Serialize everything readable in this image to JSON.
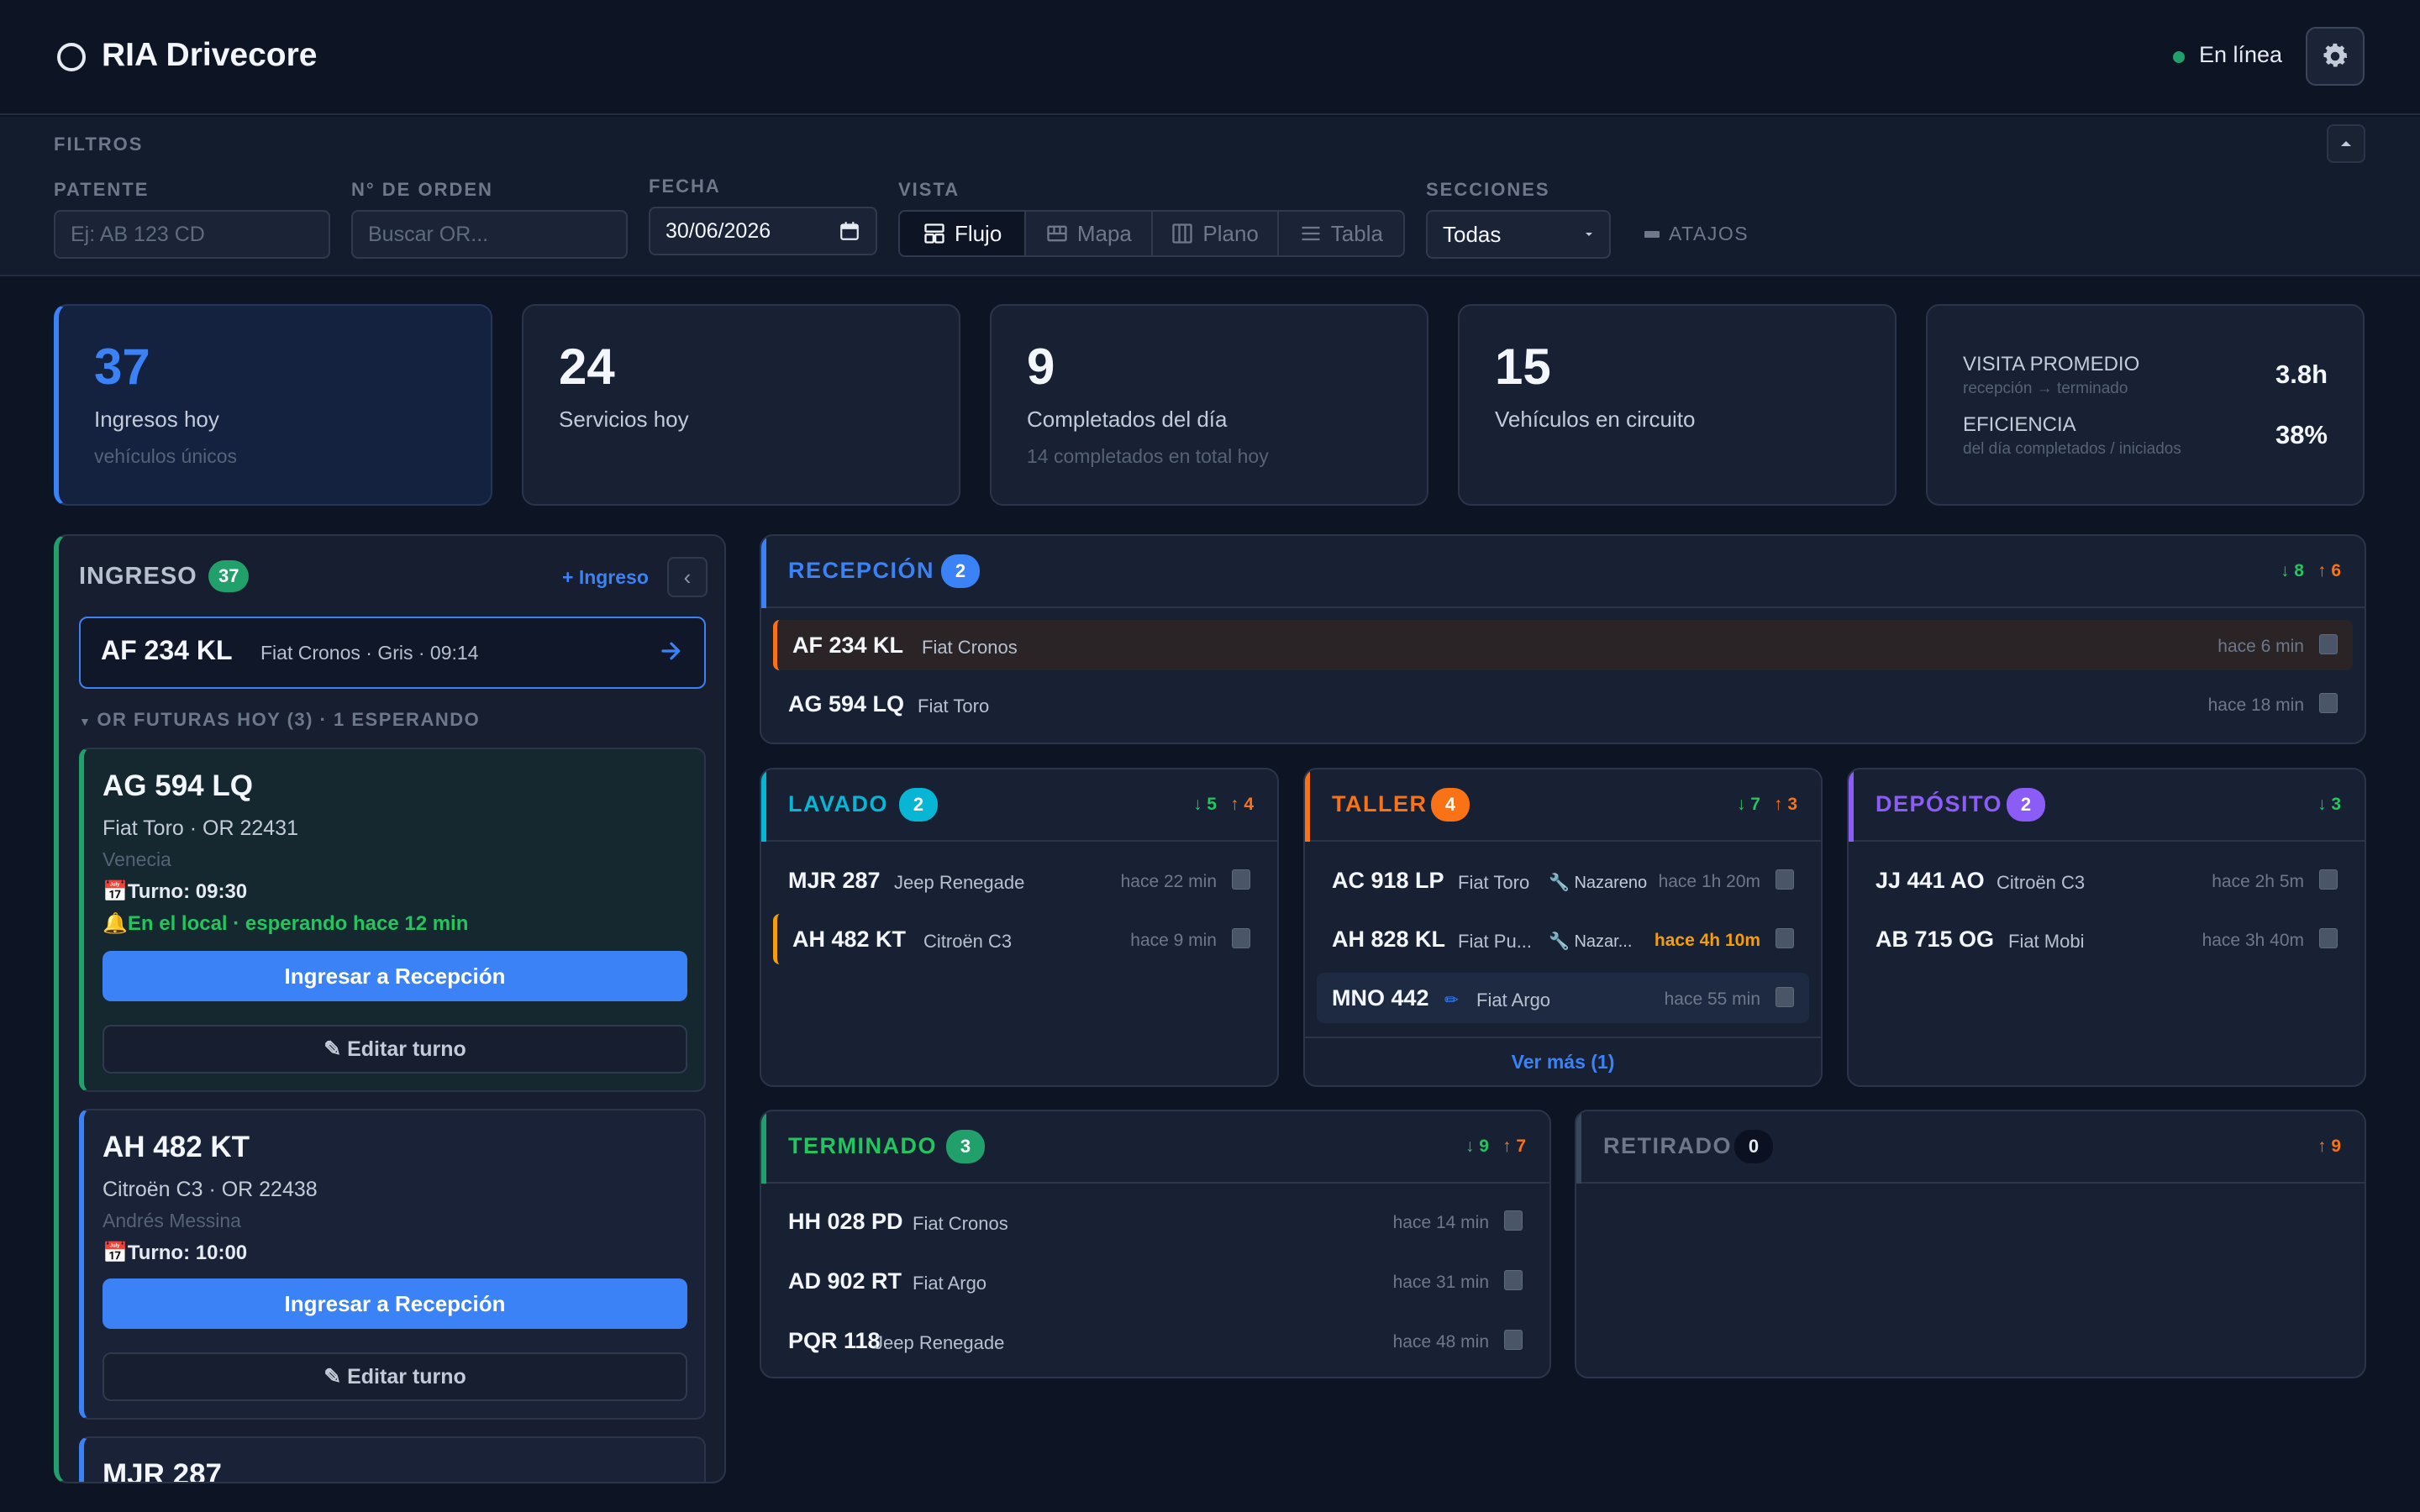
{
  "app": {
    "title": "RIA Drivecore",
    "status": "En línea"
  },
  "colors": {
    "accent": "#3b82f6",
    "success": "#22a06b",
    "warning": "#f97316",
    "purple": "#8b5cf6",
    "cyan": "#06b6d4"
  },
  "filters": {
    "label": "FILTROS",
    "patente": {
      "label": "PATENTE",
      "placeholder": "Ej: AB 123 CD"
    },
    "orden": {
      "label": "N° DE ORDEN",
      "placeholder": "Buscar OR..."
    },
    "fecha": {
      "label": "FECHA",
      "value": "30/06/2026"
    },
    "vista": {
      "label": "VISTA",
      "options": [
        "Flujo",
        "Mapa",
        "Plano",
        "Tabla"
      ],
      "selected": "Flujo"
    },
    "secciones": {
      "label": "SECCIONES",
      "value": "Todas"
    },
    "shortcuts": "ATAJOS"
  },
  "stats": [
    {
      "value": "37",
      "label": "Ingresos hoy",
      "sub": "vehículos únicos"
    },
    {
      "value": "24",
      "label": "Servicios hoy",
      "sub": ""
    },
    {
      "value": "9",
      "label": "Completados del día",
      "sub": "14 completados en total hoy"
    },
    {
      "value": "15",
      "label": "Vehículos en circuito",
      "sub": ""
    }
  ],
  "kpis": [
    {
      "label": "VISITA PROMEDIO",
      "sub": "recepción → terminado",
      "value": "3.8h"
    },
    {
      "label": "EFICIENCIA",
      "sub": "del día completados / iniciados",
      "value": "38%"
    }
  ],
  "ingreso": {
    "title": "INGRESO",
    "count": "37",
    "add": "+ Ingreso",
    "next": {
      "plate": "AF 234 KL",
      "desc": "Fiat Cronos · Gris · 09:14"
    },
    "future_label": "OR FUTURAS HOY (3) · 1 ESPERANDO",
    "cards": [
      {
        "plate": "AG 594 LQ",
        "model": "Fiat Toro · OR 22431",
        "person": "Venecia",
        "turno": "Turno: 09:30",
        "wait": "En el local · esperando hace 12 min",
        "primary": "Ingresar a Recepción",
        "secondary": "✎ Editar turno"
      },
      {
        "plate": "AH 482 KT",
        "model": "Citroën C3 · OR 22438",
        "person": "Andrés Messina",
        "turno": "Turno: 10:00",
        "primary": "Ingresar a Recepción",
        "secondary": "✎ Editar turno"
      },
      {
        "plate": "MJR 287"
      }
    ]
  },
  "sections": {
    "recepcion": {
      "title": "RECEPCIÓN",
      "count": "2",
      "in": "8",
      "out": "6",
      "rows": [
        {
          "plate": "AF 234 KL",
          "model": "Fiat Cronos",
          "time": "hace 6 min"
        },
        {
          "plate": "AG 594 LQ",
          "model": "Fiat Toro",
          "time": "hace 18 min"
        }
      ]
    },
    "lavado": {
      "title": "LAVADO",
      "count": "2",
      "in": "5",
      "out": "4",
      "rows": [
        {
          "plate": "MJR 287",
          "model": "Jeep Renegade",
          "time": "hace 22 min"
        },
        {
          "plate": "AH 482 KT",
          "model": "Citroën C3",
          "time": "hace 9 min"
        }
      ]
    },
    "taller": {
      "title": "TALLER",
      "count": "4",
      "in": "7",
      "out": "3",
      "more": "Ver más (1)",
      "rows": [
        {
          "plate": "AC 918 LP",
          "model": "Fiat Toro",
          "tech": "🔧 Nazareno",
          "time": "hace 1h 20m"
        },
        {
          "plate": "AH 828 KL",
          "model": "Fiat Pu...",
          "tech": "🔧 Nazar...",
          "time": "hace 4h 10m"
        },
        {
          "plate": "MNO 442",
          "model": "Fiat Argo",
          "tech": "✏",
          "time": "hace 55 min"
        }
      ]
    },
    "deposito": {
      "title": "DEPÓSITO",
      "count": "2",
      "in": "3",
      "rows": [
        {
          "plate": "JJ 441 AO",
          "model": "Citroën C3",
          "time": "hace 2h 5m"
        },
        {
          "plate": "AB 715 OG",
          "model": "Fiat Mobi",
          "time": "hace 3h 40m"
        }
      ]
    },
    "terminado": {
      "title": "TERMINADO",
      "count": "3",
      "in": "9",
      "out": "7",
      "rows": [
        {
          "plate": "HH 028 PD",
          "model": "Fiat Cronos",
          "time": "hace 14 min"
        },
        {
          "plate": "AD 902 RT",
          "model": "Fiat Argo",
          "time": "hace 31 min"
        },
        {
          "plate": "PQR 118",
          "model": "Jeep Renegade",
          "time": "hace 48 min"
        }
      ]
    },
    "retirado": {
      "title": "RETIRADO",
      "count": "0",
      "out": "9",
      "rows": []
    }
  }
}
